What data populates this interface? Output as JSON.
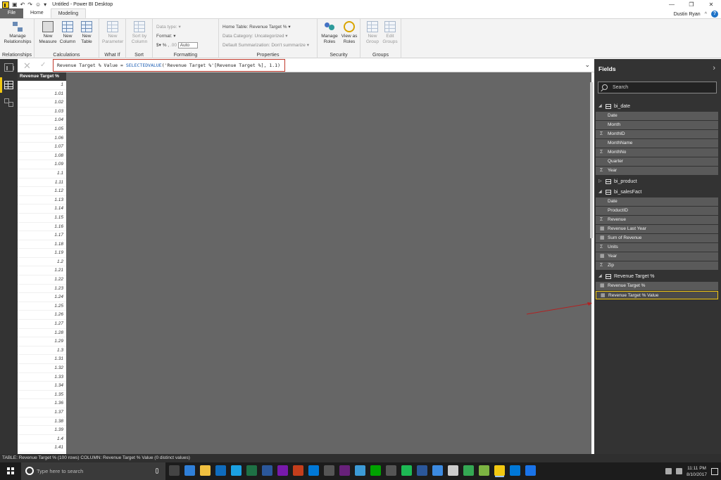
{
  "titlebar": {
    "title": "Untitled - Power BI Desktop",
    "controls": [
      "—",
      "❐",
      "✕"
    ]
  },
  "tabs": {
    "file": "File",
    "home": "Home",
    "modeling": "Modeling",
    "user": "Dustin Ryan"
  },
  "ribbon": {
    "relationships": {
      "manage_label": "Manage Relationships",
      "group": "Relationships"
    },
    "calculations": {
      "new_measure": "New Measure",
      "new_column": "New Column",
      "new_table": "New Table",
      "group": "Calculations"
    },
    "whatif": {
      "new_parameter": "New Parameter",
      "group": "What If"
    },
    "sort": {
      "sort_by_column": "Sort by Column",
      "group": "Sort"
    },
    "formatting": {
      "data_type": "Data type:",
      "format": "Format:",
      "currency": "$",
      "percent": "%",
      "comma": ",",
      "decimals": ".00",
      "auto": "Auto",
      "group": "Formatting"
    },
    "properties": {
      "home_table": "Home Table: Revenue Target %",
      "data_category": "Data Category: Uncategorized",
      "default_summarization": "Default Summarization: Don't summarize",
      "group": "Properties"
    },
    "security": {
      "manage_roles": "Manage Roles",
      "view_as_roles": "View as Roles",
      "group": "Security"
    },
    "groups": {
      "new_group": "New Group",
      "edit_groups": "Edit Groups",
      "group": "Groups"
    }
  },
  "formula": {
    "prefix": "Revenue Target % Value = ",
    "function": "SELECTEDVALUE",
    "args": "('Revenue Target %'[Revenue Target %], 1.1)"
  },
  "table": {
    "header": "Revenue Target %",
    "rows": [
      "1",
      "1.01",
      "1.02",
      "1.03",
      "1.04",
      "1.05",
      "1.06",
      "1.07",
      "1.08",
      "1.09",
      "1.1",
      "1.11",
      "1.12",
      "1.13",
      "1.14",
      "1.15",
      "1.16",
      "1.17",
      "1.18",
      "1.19",
      "1.2",
      "1.21",
      "1.22",
      "1.23",
      "1.24",
      "1.25",
      "1.26",
      "1.27",
      "1.28",
      "1.29",
      "1.3",
      "1.31",
      "1.32",
      "1.33",
      "1.34",
      "1.35",
      "1.36",
      "1.37",
      "1.38",
      "1.39",
      "1.4",
      "1.41"
    ]
  },
  "fields": {
    "title": "Fields",
    "search_placeholder": "Search",
    "tables": [
      {
        "name": "bi_date",
        "expanded": true,
        "fields": [
          {
            "name": "Date",
            "icon": ""
          },
          {
            "name": "Month",
            "icon": ""
          },
          {
            "name": "MonthID",
            "icon": "Σ"
          },
          {
            "name": "MonthName",
            "icon": ""
          },
          {
            "name": "MonthNo",
            "icon": "Σ"
          },
          {
            "name": "Quarter",
            "icon": ""
          },
          {
            "name": "Year",
            "icon": "Σ"
          }
        ]
      },
      {
        "name": "bi_product",
        "expanded": false,
        "fields": []
      },
      {
        "name": "bi_salesFact",
        "expanded": true,
        "fields": [
          {
            "name": "Date",
            "icon": ""
          },
          {
            "name": "ProductID",
            "icon": ""
          },
          {
            "name": "Revenue",
            "icon": "Σ"
          },
          {
            "name": "Revenue Last Year",
            "icon": "▦"
          },
          {
            "name": "Sum of Revenue",
            "icon": "▦"
          },
          {
            "name": "Units",
            "icon": "Σ"
          },
          {
            "name": "Year",
            "icon": "▦"
          },
          {
            "name": "Zip",
            "icon": "Σ"
          }
        ]
      },
      {
        "name": "Revenue Target %",
        "expanded": true,
        "fields": [
          {
            "name": "Revenue Target %",
            "icon": "▦"
          },
          {
            "name": "Revenue Target % Value",
            "icon": "▦",
            "selected": true
          }
        ]
      }
    ]
  },
  "status": "TABLE: Revenue Target % (100 rows) COLUMN: Revenue Target % Value (0 distinct values)",
  "taskbar": {
    "search_placeholder": "Type here to search",
    "time": "11:11 PM",
    "date": "8/10/2017",
    "apps": [
      "#444",
      "#2f7fd8",
      "#f0c040",
      "#0f6cbd",
      "#1ba1e2",
      "#1e7145",
      "#2b579a",
      "#7719aa",
      "#c43e1c",
      "#0078d7",
      "#555",
      "#68217a",
      "#3c9bd6",
      "#00a300",
      "#555",
      "#1db954",
      "#2b579a",
      "#3c8ae0",
      "#ccc",
      "#34a853",
      "#7cb342",
      "#f2c811",
      "#0078d7",
      "#1a73e8"
    ],
    "accent": "#f2c811"
  }
}
